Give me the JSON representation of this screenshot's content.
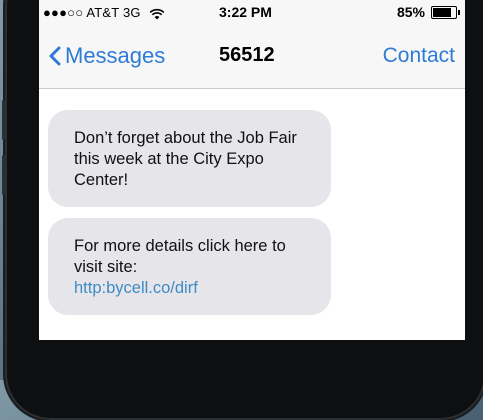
{
  "status_bar": {
    "carrier": "●●●○○ AT&T 3G",
    "time": "3:22 PM",
    "battery_percent": "85%",
    "battery_level": 0.85
  },
  "nav": {
    "back_label": "Messages",
    "title": "56512",
    "contact_label": "Contact"
  },
  "messages": [
    {
      "text": "Don’t forget about the Job Fair this week at the City Expo Center!"
    },
    {
      "text": "For more details click here to visit site:",
      "link": "http:bycell.co/dirf"
    }
  ],
  "colors": {
    "accent": "#2e7bd6",
    "bubble": "#e5e5ea",
    "link": "#3f8cc4"
  }
}
